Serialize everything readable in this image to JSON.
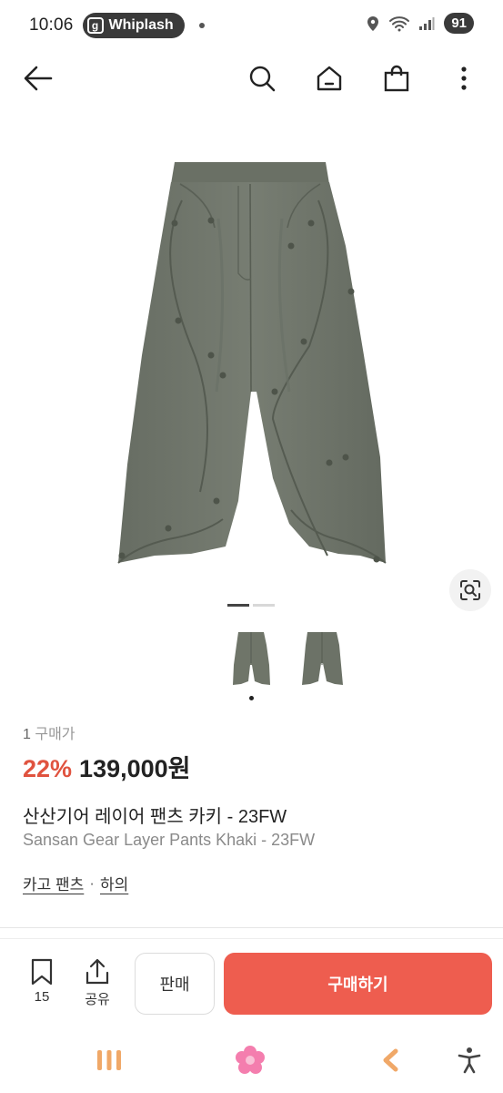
{
  "status_bar": {
    "time": "10:06",
    "app_pill_icon": "g",
    "app_pill_label": "Whiplash",
    "battery": "91"
  },
  "header": {
    "icons": [
      "back-arrow-icon",
      "search-icon",
      "home-icon",
      "shopping-bag-icon",
      "more-vertical-icon"
    ]
  },
  "gallery": {
    "image_count": 2,
    "active_index": 0
  },
  "product": {
    "buy_count_num": "1",
    "buy_count_label": "구매가",
    "discount": "22%",
    "price": "139,000원",
    "title_ko": "산산기어 레이어 팬츠 카키 - 23FW",
    "title_en": "Sansan Gear Layer Pants Khaki - 23FW",
    "categories": [
      "카고 팬츠",
      "하의"
    ],
    "category_separator": "·"
  },
  "actions": {
    "bookmark_count": "15",
    "share_label": "공유",
    "sell_label": "판매",
    "buy_label": "구매하기"
  },
  "colors": {
    "accent": "#ee5d4f",
    "discount": "#e0533f",
    "pants": "#6f7569"
  }
}
